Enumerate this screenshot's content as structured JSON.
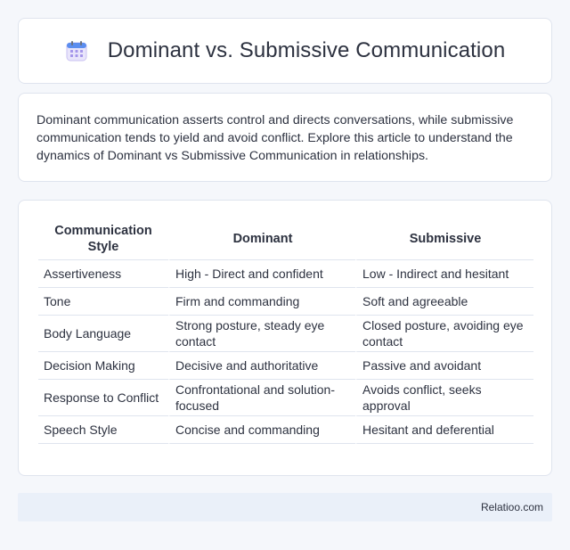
{
  "header": {
    "title": "Dominant vs. Submissive Communication",
    "icon": "calendar-icon"
  },
  "intro": {
    "text": "Dominant communication asserts control and directs conversations, while submissive communication tends to yield and avoid conflict. Explore this article to understand the dynamics of Dominant vs Submissive Communication in relationships."
  },
  "table": {
    "headers": [
      "Communication Style",
      "Dominant",
      "Submissive"
    ],
    "rows": [
      [
        "Assertiveness",
        "High - Direct and confident",
        "Low - Indirect and hesitant"
      ],
      [
        "Tone",
        "Firm and commanding",
        "Soft and agreeable"
      ],
      [
        "Body Language",
        "Strong posture, steady eye contact",
        "Closed posture, avoiding eye contact"
      ],
      [
        "Decision Making",
        "Decisive and authoritative",
        "Passive and avoidant"
      ],
      [
        "Response to Conflict",
        "Confrontational and solution-focused",
        "Avoids conflict, seeks approval"
      ],
      [
        "Speech Style",
        "Concise and commanding",
        "Hesitant and deferential"
      ]
    ]
  },
  "footer": {
    "brand": "Relatioo.com"
  },
  "colors": {
    "background": "#f5f7fb",
    "card": "#ffffff",
    "border": "#dfe4ee",
    "footer": "#eaf0f9",
    "text": "#2d3240",
    "icon_accent": "#8a7fd8"
  }
}
